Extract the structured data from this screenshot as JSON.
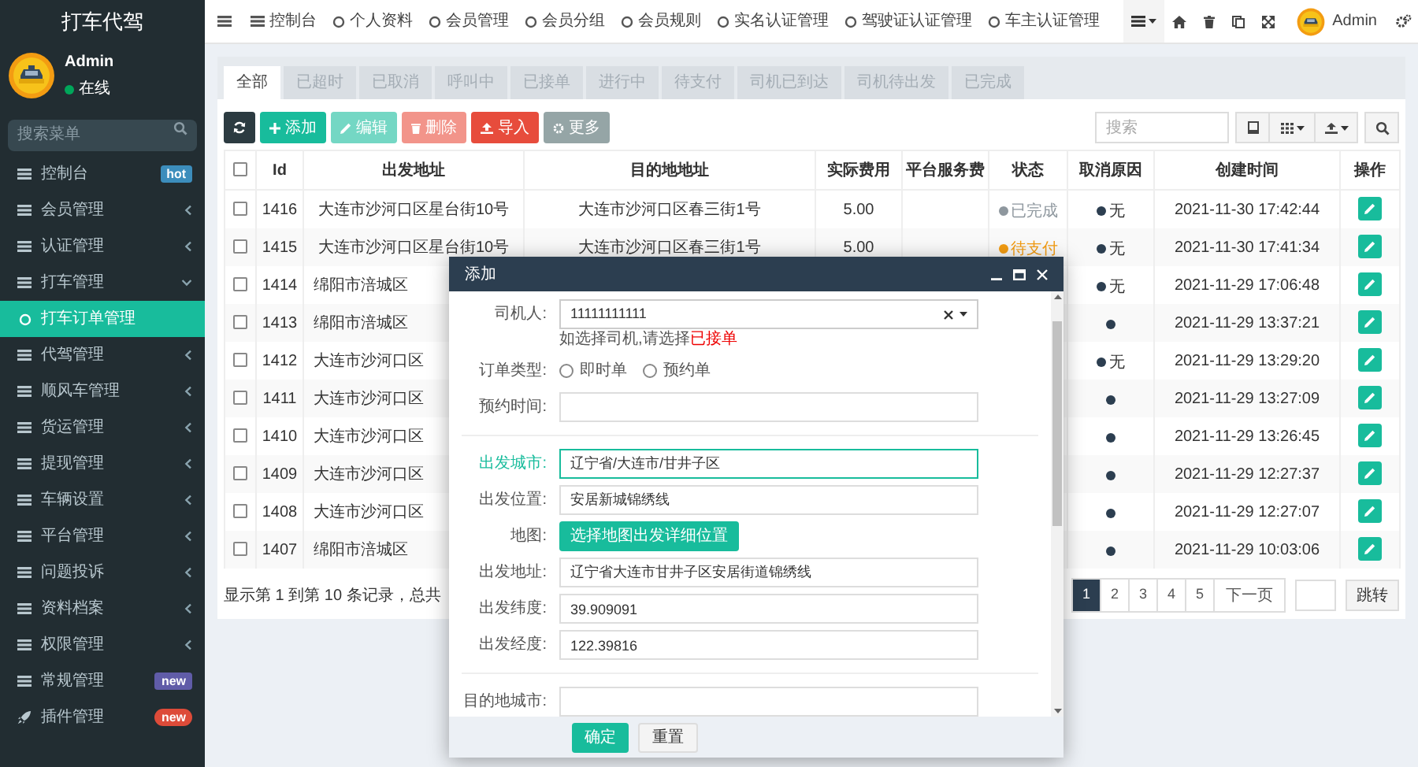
{
  "sidebar": {
    "brand": "打车代驾",
    "user": {
      "name": "Admin",
      "status": "在线"
    },
    "search": {
      "placeholder": "搜索菜单"
    },
    "menu": [
      {
        "label": "控制台",
        "selected": false,
        "badge": {
          "text": "hot",
          "color": "#3c8dbc"
        }
      },
      {
        "label": "会员管理",
        "selected": false,
        "expanded": false
      },
      {
        "label": "认证管理",
        "selected": false,
        "expanded": false
      },
      {
        "label": "打车管理",
        "selected": false,
        "expanded": true,
        "children": [
          {
            "label": "打车订单管理",
            "selected": true
          }
        ]
      },
      {
        "label": "代驾管理",
        "selected": false,
        "expanded": false
      },
      {
        "label": "顺风车管理",
        "selected": false,
        "expanded": false
      },
      {
        "label": "货运管理",
        "selected": false,
        "expanded": false
      },
      {
        "label": "提现管理",
        "selected": false,
        "expanded": false
      },
      {
        "label": "车辆设置",
        "selected": false,
        "expanded": false
      },
      {
        "label": "平台管理",
        "selected": false,
        "expanded": false
      },
      {
        "label": "问题投诉",
        "selected": false,
        "expanded": false
      },
      {
        "label": "资料档案",
        "selected": false,
        "expanded": false
      },
      {
        "label": "权限管理",
        "selected": false,
        "expanded": false
      },
      {
        "label": "常规管理",
        "selected": false,
        "badge": {
          "text": "new",
          "color": "#605ca8"
        }
      },
      {
        "label": "插件管理",
        "selected": false,
        "badge": {
          "text": "new",
          "color": "#dd4b39"
        }
      }
    ]
  },
  "topbar": {
    "tabs": [
      {
        "label": "控制台"
      },
      {
        "label": "个人资料"
      },
      {
        "label": "会员管理"
      },
      {
        "label": "会员分组"
      },
      {
        "label": "会员规则"
      },
      {
        "label": "实名认证管理"
      },
      {
        "label": "驾驶证认证管理"
      },
      {
        "label": "车主认证管理"
      }
    ],
    "user": "Admin"
  },
  "tabs": [
    {
      "label": "全部",
      "selected": true
    },
    {
      "label": "已超时",
      "selected": false
    },
    {
      "label": "已取消",
      "selected": false
    },
    {
      "label": "呼叫中",
      "selected": false
    },
    {
      "label": "已接单",
      "selected": false
    },
    {
      "label": "进行中",
      "selected": false
    },
    {
      "label": "待支付",
      "selected": false
    },
    {
      "label": "司机已到达",
      "selected": false
    },
    {
      "label": "司机待出发",
      "selected": false
    },
    {
      "label": "已完成",
      "selected": false
    }
  ],
  "toolbar": {
    "buttons": [
      {
        "kind": "refresh",
        "disabled": false
      },
      {
        "kind": "add",
        "label": "添加",
        "disabled": false
      },
      {
        "kind": "edit",
        "label": "编辑",
        "disabled": true
      },
      {
        "kind": "delete",
        "label": "删除",
        "disabled": true
      },
      {
        "kind": "import",
        "label": "导入",
        "disabled": false
      },
      {
        "kind": "more",
        "label": "更多",
        "disabled": false
      }
    ],
    "search": {
      "placeholder": "搜索"
    }
  },
  "table": {
    "all_checked": false,
    "columns": [
      "Id",
      "出发地址",
      "目的地地址",
      "实际费用",
      "平台服务费",
      "状态",
      "取消原因",
      "创建时间",
      "操作"
    ],
    "rows": [
      {
        "checked": false,
        "id": "1416",
        "start": "大连市沙河口区星台街10号",
        "dest": "大连市沙河口区春三街1号",
        "fee": "5.00",
        "status": {
          "label": "已完成",
          "color": "#8e979e"
        },
        "cancel_reason": "无",
        "time": "2021-11-30 17:42:44"
      },
      {
        "checked": false,
        "id": "1415",
        "start": "大连市沙河口区星台街10号",
        "dest": "大连市沙河口区春三街1号",
        "fee": "5.00",
        "status": {
          "label": "待支付",
          "color": "#f39c12"
        },
        "cancel_reason": "无",
        "time": "2021-11-30 17:41:34"
      },
      {
        "checked": false,
        "id": "1414",
        "start": "绵阳市涪城区",
        "cancel_reason": "无",
        "time": "2021-11-29 17:06:48"
      },
      {
        "checked": false,
        "id": "1413",
        "start": "绵阳市涪城区",
        "time": "2021-11-29 13:37:21"
      },
      {
        "checked": false,
        "id": "1412",
        "start": "大连市沙河口区",
        "cancel_reason": "无",
        "time": "2021-11-29 13:29:20"
      },
      {
        "checked": false,
        "id": "1411",
        "start": "大连市沙河口区",
        "time": "2021-11-29 13:27:09"
      },
      {
        "checked": false,
        "id": "1410",
        "start": "大连市沙河口区",
        "time": "2021-11-29 13:26:45"
      },
      {
        "checked": false,
        "id": "1409",
        "start": "大连市沙河口区",
        "time": "2021-11-29 12:27:37"
      },
      {
        "checked": false,
        "id": "1408",
        "start": "大连市沙河口区",
        "time": "2021-11-29 12:27:07"
      },
      {
        "checked": false,
        "id": "1407",
        "start": "绵阳市涪城区",
        "time": "2021-11-29 10:03:06"
      }
    ]
  },
  "pagination": {
    "summary": "显示第 1 到第 10 条记录，总共",
    "pages": [
      {
        "label": "1",
        "selected": true
      },
      {
        "label": "2",
        "selected": false
      },
      {
        "label": "3",
        "selected": false
      },
      {
        "label": "4",
        "selected": false
      },
      {
        "label": "5",
        "selected": false
      }
    ],
    "next": "下一页",
    "jump": "跳转"
  },
  "modal": {
    "title": "添加",
    "fields": [
      {
        "kind": "select",
        "label": "司机人:",
        "value": "11111111111",
        "hint": "如选择司机,请选择",
        "hint_emphasis": "已接单"
      },
      {
        "kind": "radio",
        "label": "订单类型:",
        "options": [
          {
            "label": "即时单",
            "checked": false
          },
          {
            "label": "预约单",
            "checked": false
          }
        ]
      },
      {
        "kind": "input",
        "label": "预约时间:",
        "focused": false
      },
      {
        "kind": "divider"
      },
      {
        "kind": "input",
        "label": "出发城市:",
        "value": "辽宁省/大连市/甘井子区",
        "focused": true
      },
      {
        "kind": "input",
        "label": "出发位置:",
        "value": "安居新城锦绣线",
        "focused": false
      },
      {
        "kind": "button",
        "label": "地图:",
        "button": "选择地图出发详细位置"
      },
      {
        "kind": "input",
        "label": "出发地址:",
        "value": "辽宁省大连市甘井子区安居街道锦绣线",
        "focused": false
      },
      {
        "kind": "input",
        "label": "出发纬度:",
        "value": "39.909091",
        "focused": false
      },
      {
        "kind": "input",
        "label": "出发经度:",
        "value": "122.39816",
        "focused": false
      },
      {
        "kind": "divider"
      },
      {
        "kind": "input",
        "label": "目的地城市:",
        "focused": false
      }
    ],
    "buttons": [
      {
        "kind": "primary",
        "label": "确定"
      },
      {
        "kind": "default",
        "label": "重置"
      }
    ]
  }
}
